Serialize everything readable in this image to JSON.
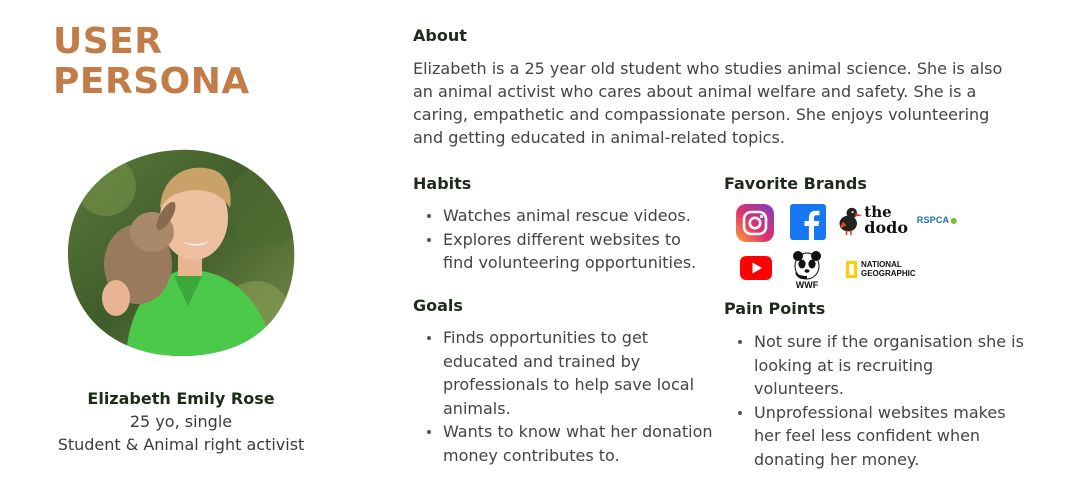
{
  "title": {
    "line1": "USER",
    "line2": "PERSONA"
  },
  "persona": {
    "name": "Elizabeth Emily Rose",
    "age_status": "25 yo, single",
    "occupation": "Student & Animal right activist"
  },
  "about": {
    "heading": "About",
    "text": "Elizabeth is a 25 year old student who studies animal science. She is also an animal activist who cares about animal welfare and safety. She is a caring, empathetic and compassionate person. She enjoys volunteering and getting educated in animal-related topics."
  },
  "habits": {
    "heading": "Habits",
    "items": [
      "Watches animal rescue videos.",
      "Explores different websites to find volunteering opportunities."
    ]
  },
  "goals": {
    "heading": "Goals",
    "items": [
      "Finds opportunities to get educated and trained by professionals to help save local animals.",
      "Wants to know what her donation money contributes to."
    ]
  },
  "brands": {
    "heading": "Favorite Brands",
    "logos": {
      "instagram": "instagram-icon",
      "facebook": "facebook-icon",
      "dodo_line1": "the",
      "dodo_line2": "dodo",
      "rspca": "RSPCA",
      "youtube": "youtube-icon",
      "wwf": "WWF",
      "natgeo_line1": "NATIONAL",
      "natgeo_line2": "GEOGRAPHIC"
    }
  },
  "pain_points": {
    "heading": "Pain Points",
    "items": [
      "Not sure if the organisation she is looking at is recruiting volunteers.",
      "Unprofessional websites makes her feel less confident when donating her money."
    ]
  },
  "colors": {
    "accent": "#c27c47",
    "heading": "#1f2a1c",
    "text": "#444444"
  }
}
